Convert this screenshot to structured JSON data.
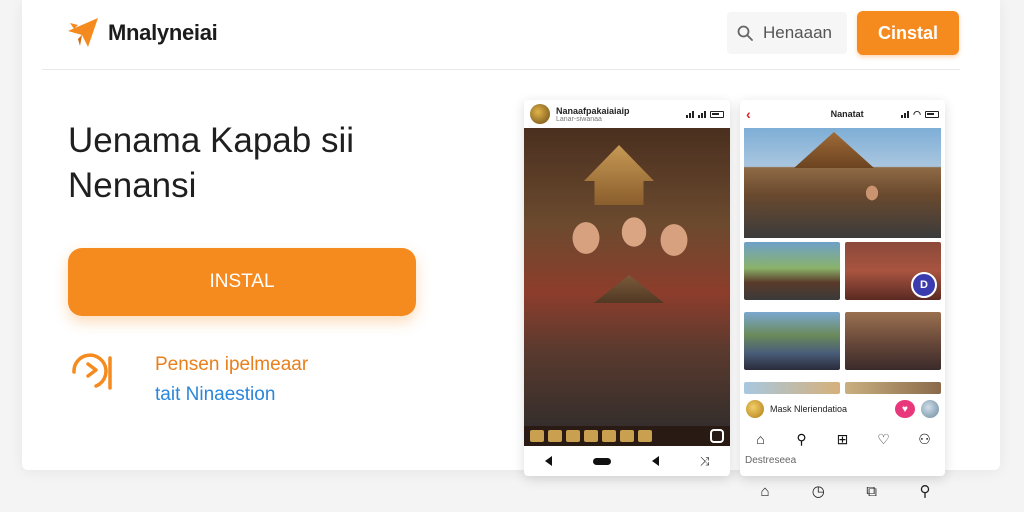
{
  "header": {
    "brand": "Mnalyneiai",
    "search_label": "Henaaan",
    "install_label": "Cinstal"
  },
  "hero": {
    "headline_line1": "Uenama Kapab sii",
    "headline_line2": "Nenansi",
    "cta_label": "INSTAL"
  },
  "feature": {
    "line1": "Pensen ipelmeaar",
    "line2": "tait Ninaestion"
  },
  "phone1": {
    "account_name": "Nanaafpakaiaiaip",
    "account_sub": "Lanar-siwanaa"
  },
  "phone2": {
    "title": "Nanatat",
    "badge": "D",
    "profile_name": "Mask Nleriendatioa"
  },
  "below_phones": {
    "caption": "Destreseea"
  },
  "colors": {
    "accent_orange": "#f58a1f",
    "link_blue": "#2a86d8",
    "badge_blue": "#3b3bb0",
    "heart_pink": "#e8377a"
  }
}
